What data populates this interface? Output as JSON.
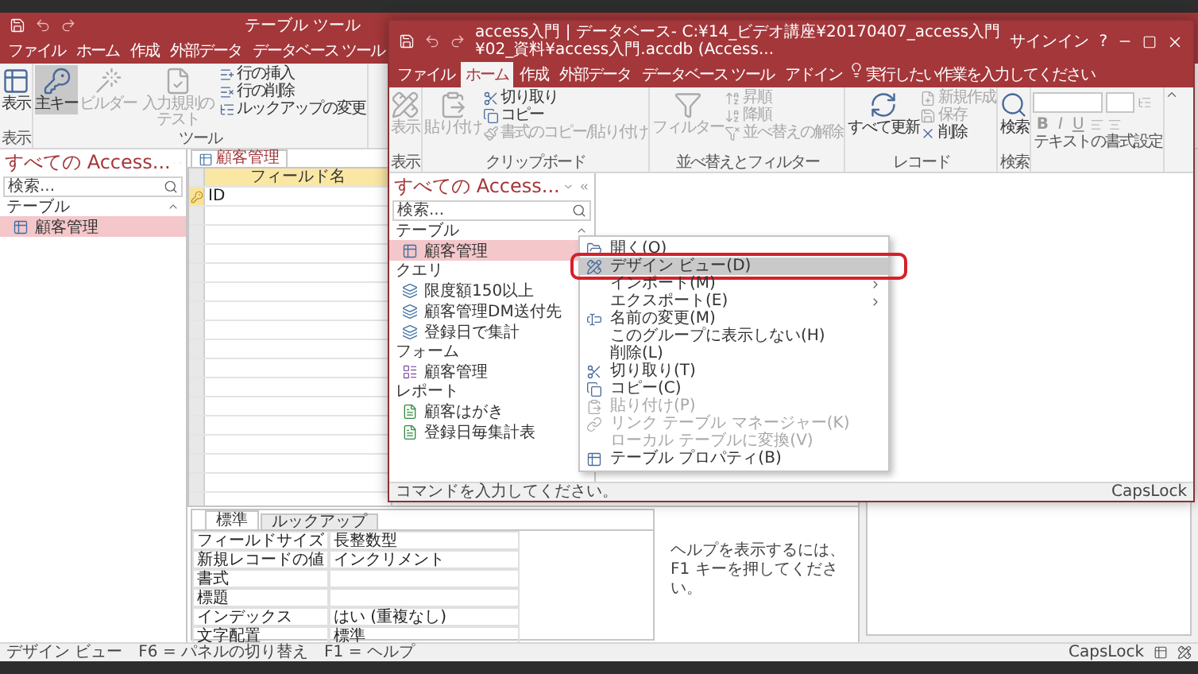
{
  "back_window": {
    "contextual_label": "テーブル ツール",
    "tabs": [
      {
        "label": "ファイル",
        "selected": false
      },
      {
        "label": "ホーム",
        "selected": false
      },
      {
        "label": "作成",
        "selected": false
      },
      {
        "label": "外部データ",
        "selected": false
      },
      {
        "label": "データベース ツール",
        "selected": false
      }
    ],
    "ribbon": [
      {
        "label": "表示",
        "items": [
          {
            "kind": "large",
            "label": "表示",
            "disabled": false,
            "selected": false
          }
        ]
      },
      {
        "label": "ツール",
        "items": [
          {
            "kind": "large",
            "label": "主キー",
            "disabled": false,
            "selected": true
          },
          {
            "kind": "large",
            "label": "ビルダー",
            "disabled": true,
            "selected": false
          },
          {
            "kind": "large",
            "label": "入力規則のテスト",
            "disabled": true,
            "selected": false
          },
          {
            "kind": "small",
            "label": "行の挿入",
            "disabled": false,
            "selected": false
          },
          {
            "kind": "small",
            "label": "行の削除",
            "disabled": false,
            "selected": false
          },
          {
            "kind": "small",
            "label": "ルックアップの変更",
            "disabled": false,
            "selected": false
          }
        ]
      }
    ],
    "nav_pane": {
      "title": "すべての Access...",
      "search": {
        "placeholder": "検索..."
      },
      "groups": [
        {
          "label": "テーブル",
          "items": [
            {
              "label": "顧客管理",
              "kind": "table",
              "selected": true
            }
          ]
        }
      ]
    },
    "document_tab": {
      "label": "顧客管理"
    },
    "design_grid": {
      "column_header": "フィールド名",
      "rows": [
        {
          "field": "ID",
          "primary_key": true,
          "selected": true
        }
      ]
    },
    "field_properties": {
      "tabs": [
        {
          "label": "標準",
          "selected": true
        },
        {
          "label": "ルックアップ",
          "selected": false
        }
      ],
      "rows": [
        {
          "name": "フィールドサイズ",
          "value": "長整数型"
        },
        {
          "name": "新規レコードの値",
          "value": "インクリメント"
        },
        {
          "name": "書式"
        },
        {
          "name": "標題"
        },
        {
          "name": "インデックス",
          "value": "はい (重複なし)"
        },
        {
          "name": "文字配置",
          "value": "標準"
        }
      ]
    },
    "help_text": "ヘルプを表示するには、F1 キーを押してください。",
    "status_bar": {
      "text": "デザイン ビュー　F6 = パネルの切り替え　F1 = ヘルプ",
      "caps_lock": "CapsLock"
    }
  },
  "front_window": {
    "title": "access入門 | データベース- C:¥14_ビデオ講座¥20170407_access入門¥02_資料¥access入門.accdb (Access...",
    "sign_in": "サインイン",
    "help": "?",
    "tabs": [
      {
        "label": "ファイル",
        "selected": false
      },
      {
        "label": "ホーム",
        "selected": true
      },
      {
        "label": "作成",
        "selected": false
      },
      {
        "label": "外部データ",
        "selected": false
      },
      {
        "label": "データベース ツール",
        "selected": false
      },
      {
        "label": "アドイン",
        "selected": false
      }
    ],
    "tell_me": "実行したい作業を入力してください",
    "ribbon": [
      {
        "label": "表示",
        "items": [
          {
            "kind": "large",
            "label": "表示",
            "disabled": true
          }
        ]
      },
      {
        "label": "クリップボード",
        "items": [
          {
            "kind": "large",
            "label": "貼り付け",
            "disabled": true
          },
          {
            "kind": "small",
            "label": "切り取り",
            "disabled": false
          },
          {
            "kind": "small",
            "label": "コピー",
            "disabled": false
          },
          {
            "kind": "small",
            "label": "書式のコピー/貼り付け",
            "disabled": true
          }
        ]
      },
      {
        "label": "並べ替えとフィルター",
        "items": [
          {
            "kind": "large",
            "label": "フィルター",
            "disabled": true
          },
          {
            "kind": "small",
            "label": "昇順",
            "disabled": true
          },
          {
            "kind": "small",
            "label": "降順",
            "disabled": true
          },
          {
            "kind": "small",
            "label": "並べ替えの解除",
            "disabled": true
          }
        ]
      },
      {
        "label": "レコード",
        "items": [
          {
            "kind": "large",
            "label": "すべて更新",
            "disabled": false
          },
          {
            "kind": "small",
            "label": "新規作成",
            "disabled": true
          },
          {
            "kind": "small",
            "label": "保存",
            "disabled": true
          },
          {
            "kind": "small",
            "label": "削除",
            "disabled": false
          }
        ]
      },
      {
        "label": "検索",
        "items": [
          {
            "kind": "large",
            "label": "検索",
            "disabled": false
          }
        ]
      }
    ],
    "text_format": {
      "label": "テキストの書式設定",
      "buttons": [
        "B",
        "I",
        "U"
      ]
    },
    "nav_pane": {
      "title": "すべての Access...",
      "search": {
        "placeholder": "検索..."
      },
      "groups": [
        {
          "label": "テーブル",
          "items": [
            {
              "label": "顧客管理",
              "kind": "table",
              "selected": true
            }
          ]
        },
        {
          "label": "クエリ",
          "items": [
            {
              "label": "限度額150以上",
              "kind": "query",
              "selected": false
            },
            {
              "label": "顧客管理DM送付先",
              "kind": "query",
              "selected": false
            },
            {
              "label": "登録日で集計",
              "kind": "query",
              "selected": false
            }
          ]
        },
        {
          "label": "フォーム",
          "items": [
            {
              "label": "顧客管理",
              "kind": "form",
              "selected": false
            }
          ]
        },
        {
          "label": "レポート",
          "items": [
            {
              "label": "顧客はがき",
              "kind": "report",
              "selected": false
            },
            {
              "label": "登録日毎集計表",
              "kind": "report",
              "selected": false
            }
          ]
        }
      ]
    },
    "status_bar": {
      "text": "コマンドを入力してください。",
      "caps_lock": "CapsLock"
    }
  },
  "context_menu": {
    "items": [
      {
        "label": "開く(O)",
        "submenu": false,
        "disabled": false,
        "selected": false
      },
      {
        "label": "デザイン ビュー(D)",
        "submenu": false,
        "disabled": false,
        "selected": true
      },
      {
        "label": "インポート(M)",
        "submenu": true,
        "disabled": false,
        "selected": false
      },
      {
        "label": "エクスポート(E)",
        "submenu": true,
        "disabled": false,
        "selected": false
      },
      {
        "label": "名前の変更(M)",
        "submenu": false,
        "disabled": false,
        "selected": false
      },
      {
        "label": "このグループに表示しない(H)",
        "submenu": false,
        "disabled": false,
        "selected": false
      },
      {
        "label": "削除(L)",
        "submenu": false,
        "disabled": false,
        "selected": false
      },
      {
        "label": "切り取り(T)",
        "submenu": false,
        "disabled": false,
        "selected": false
      },
      {
        "label": "コピー(C)",
        "submenu": false,
        "disabled": false,
        "selected": false
      },
      {
        "label": "貼り付け(P)",
        "submenu": false,
        "disabled": true,
        "selected": false
      },
      {
        "label": "リンク テーブル マネージャー(K)",
        "submenu": false,
        "disabled": true,
        "selected": false
      },
      {
        "label": "ローカル テーブルに変換(V)",
        "submenu": false,
        "disabled": true,
        "selected": false
      },
      {
        "label": "テーブル プロパティ(B)",
        "submenu": false,
        "disabled": false,
        "selected": false
      }
    ]
  }
}
